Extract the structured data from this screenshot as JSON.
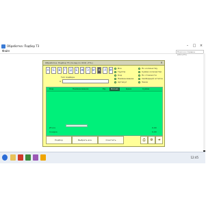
{
  "window": {
    "title": "Обработка: Подбор ТЗ",
    "minimize": "–",
    "maximize": "□",
    "close": "×"
  },
  "menu": {
    "file": "Файл",
    "search_placeholder": "Поиск в справке (Ctrl+F1)"
  },
  "dialog": {
    "title": "Обработка: Подбор ТЗ (Склад по ООО «ТЗ»)",
    "close": "×",
    "nav_buttons": [
      "А",
      "Б",
      "В",
      "Г",
      "Д",
      "Е",
      "Ж",
      "З",
      "И",
      "К",
      "Л",
      "М",
      "Н",
      "О",
      "П",
      "Р",
      "С"
    ],
    "select_label": "Тип подбора",
    "select_prefix": "А",
    "options_left": [
      "Все",
      "Группа",
      "Код",
      "Наименование",
      "Артикул"
    ],
    "options_right": [
      "По количеству",
      "Сумма количество",
      "По стоимости",
      "Свободный остаток",
      "Заказ"
    ],
    "grid": {
      "headers": [
        "Код",
        "Наименование",
        "Ед.",
        "Кол-во",
        "Цена",
        "Сумма"
      ],
      "active_header": "Кол-во",
      "footer_rows": [
        {
          "label": "Итого",
          "value": "0,00"
        },
        {
          "label": "Скидка",
          "value": "0,00"
        }
      ]
    },
    "buttons": {
      "pick": "Подбор",
      "select_all": "Выбрать все",
      "clear": "Очистить",
      "print_icon": "printer-icon",
      "settings_icon": "gear-icon",
      "exit_icon": "exit-icon"
    }
  },
  "taskbar": {
    "time": "12:45"
  }
}
